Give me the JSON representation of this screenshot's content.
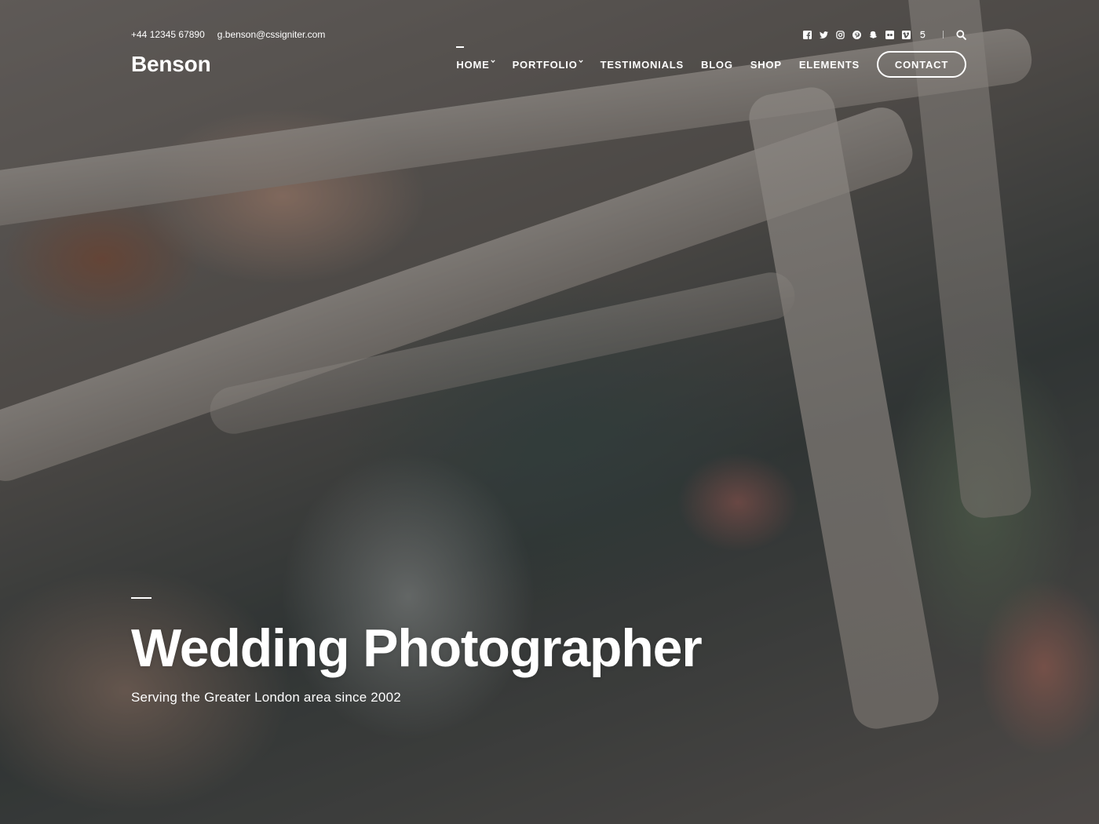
{
  "topbar": {
    "phone": "+44 12345 67890",
    "email": "g.benson@cssigniter.com",
    "social_icons": [
      "facebook-icon",
      "twitter-icon",
      "instagram-icon",
      "pinterest-icon",
      "snapchat-icon",
      "flickr-icon",
      "vimeo-icon",
      "500px-icon"
    ],
    "search_icon": "search-icon"
  },
  "header": {
    "logo": "Benson",
    "nav": [
      {
        "label": "HOME",
        "has_dropdown": true,
        "active": true
      },
      {
        "label": "PORTFOLIO",
        "has_dropdown": true,
        "active": false
      },
      {
        "label": "TESTIMONIALS",
        "has_dropdown": false,
        "active": false
      },
      {
        "label": "BLOG",
        "has_dropdown": false,
        "active": false
      },
      {
        "label": "SHOP",
        "has_dropdown": false,
        "active": false
      },
      {
        "label": "ELEMENTS",
        "has_dropdown": false,
        "active": false
      }
    ],
    "cta_label": "CONTACT"
  },
  "hero": {
    "title": "Wedding Photographer",
    "subtitle": "Serving the Greater London area since 2002"
  },
  "colors": {
    "text": "#ffffff",
    "overlay": "#1e1e1e"
  }
}
